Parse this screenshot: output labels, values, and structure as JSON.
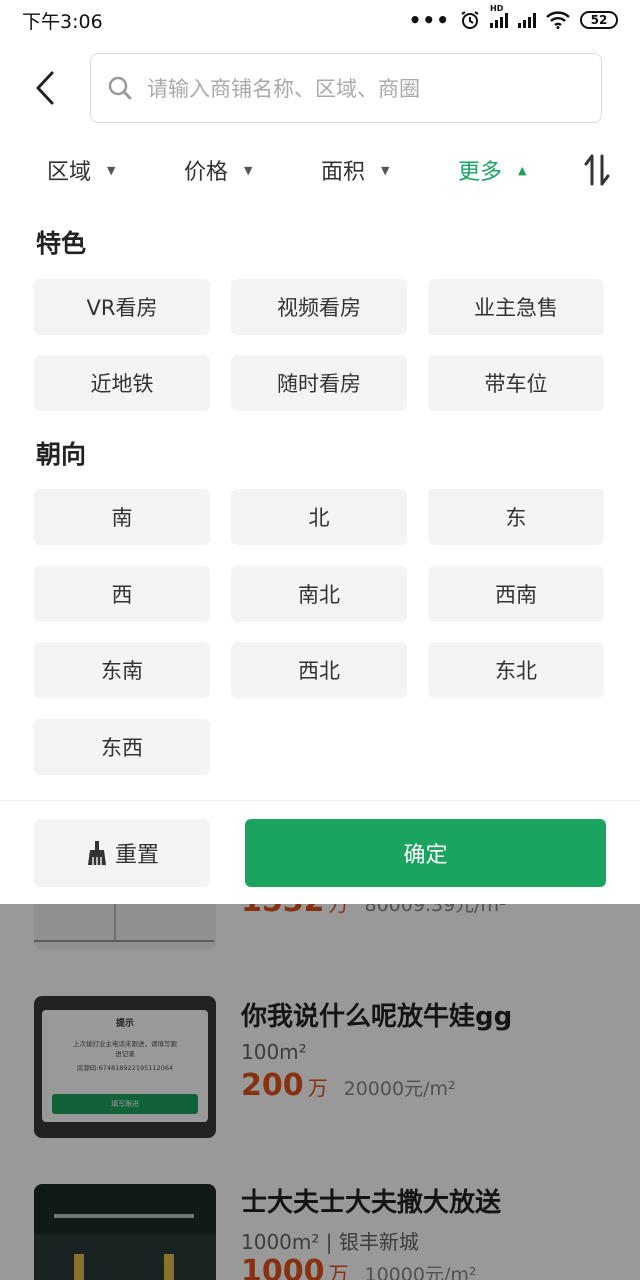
{
  "status_bar": {
    "time": "下午3:06",
    "hd_label": "HD",
    "battery": "52"
  },
  "search": {
    "placeholder": "请输入商铺名称、区域、商圈"
  },
  "filter_tabs": [
    {
      "label": "区域",
      "active": false
    },
    {
      "label": "价格",
      "active": false
    },
    {
      "label": "面积",
      "active": false
    },
    {
      "label": "更多",
      "active": true
    }
  ],
  "features": {
    "title": "特色",
    "options": [
      "VR看房",
      "视频看房",
      "业主急售",
      "近地铁",
      "随时看房",
      "带车位"
    ]
  },
  "orientation": {
    "title": "朝向",
    "options": [
      "南",
      "北",
      "东",
      "西",
      "南北",
      "西南",
      "东南",
      "西北",
      "东北",
      "东西"
    ]
  },
  "actions": {
    "reset_label": "重置",
    "confirm_label": "确定"
  },
  "listings": [
    {
      "title": "",
      "price_value": "1532",
      "price_unit": "万",
      "unit_price": "80009.39元/m²"
    },
    {
      "title": "你我说什么呢放牛娃gg",
      "meta": "100m²",
      "price_value": "200",
      "price_unit": "万",
      "unit_price": "20000元/m²",
      "thumb_dialog": {
        "title": "提示",
        "line1": "上次拨打业主电话未跟进，请填写跟",
        "line2": "进记录",
        "line3": "房源码:674818922195112064",
        "button": "填写跟进"
      }
    },
    {
      "title": "士大夫士大夫撒大放送",
      "meta": "1000m² | 银丰新城",
      "price_value": "1000",
      "price_unit": "万",
      "unit_price": "10000元/m²"
    }
  ],
  "colors": {
    "accent": "#1aa45f",
    "price": "#e0521e",
    "chip_bg": "#f4f4f4"
  }
}
